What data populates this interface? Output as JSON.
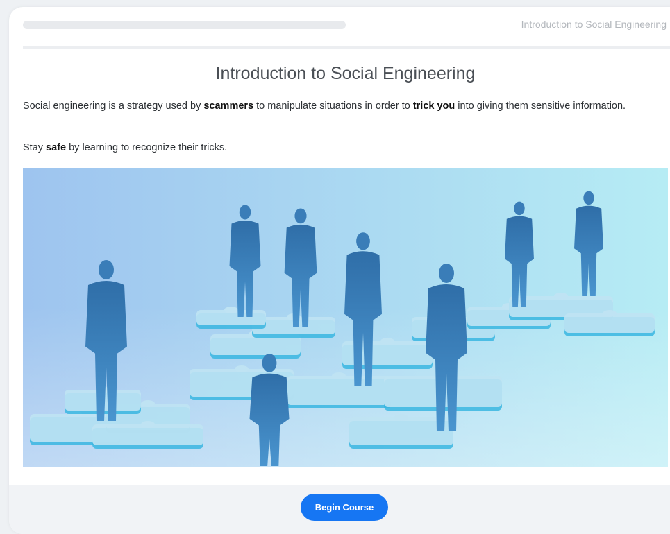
{
  "header": {
    "course_title": "Introduction to Social Engineering",
    "progress_fraction": 0.0
  },
  "content": {
    "title": "Introduction to Social Engineering",
    "para1": {
      "t1": "Social engineering is a strategy used by ",
      "b1": "scammers",
      "t2": " to manipulate situations in order to ",
      "b2": "trick you",
      "t3": " into giving them sensitive information."
    },
    "para2": {
      "t1": "Stay ",
      "b1": "safe",
      "t2": " by learning to recognize their tricks."
    }
  },
  "hero_image": {
    "subject": "business people silhouettes standing on puzzle pieces",
    "colors": {
      "bg_left": "#9ec4ef",
      "bg_right": "#b6ecf4",
      "silhouette": "#3a7db8",
      "puzzle": "#bfe3f3",
      "puzzle_edge": "#3ab6e0"
    }
  },
  "footer": {
    "begin_label": "Begin Course"
  },
  "colors": {
    "accent": "#1676f3"
  }
}
